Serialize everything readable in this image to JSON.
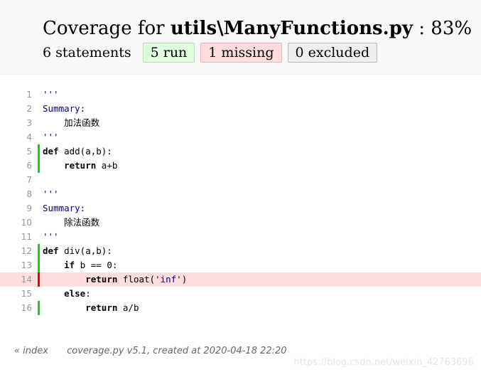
{
  "header": {
    "title_prefix": "Coverage for ",
    "title_file": "utils\\ManyFunctions.py",
    "title_suffix": " : 83%",
    "statements_label": "6 statements",
    "run_label": "5 run",
    "missing_label": "1 missing",
    "excluded_label": "0 excluded"
  },
  "source_lines": [
    {
      "n": "1",
      "status": "",
      "segments": [
        {
          "t": "'''",
          "c": "str"
        }
      ]
    },
    {
      "n": "2",
      "status": "",
      "segments": [
        {
          "t": "Summary:",
          "c": "str"
        }
      ]
    },
    {
      "n": "3",
      "status": "",
      "segments": [
        {
          "t": "    加法函数",
          "c": ""
        }
      ]
    },
    {
      "n": "4",
      "status": "",
      "segments": [
        {
          "t": "'''",
          "c": "str"
        }
      ]
    },
    {
      "n": "5",
      "status": "run",
      "segments": [
        {
          "t": "def",
          "c": "kw"
        },
        {
          "t": " add(a,b):",
          "c": ""
        }
      ]
    },
    {
      "n": "6",
      "status": "run",
      "segments": [
        {
          "t": "    ",
          "c": ""
        },
        {
          "t": "return",
          "c": "kw"
        },
        {
          "t": " a+b",
          "c": ""
        }
      ]
    },
    {
      "n": "7",
      "status": "",
      "segments": [
        {
          "t": "",
          "c": ""
        }
      ]
    },
    {
      "n": "8",
      "status": "",
      "segments": [
        {
          "t": "'''",
          "c": "str"
        }
      ]
    },
    {
      "n": "9",
      "status": "",
      "segments": [
        {
          "t": "Summary:",
          "c": "str"
        }
      ]
    },
    {
      "n": "10",
      "status": "",
      "segments": [
        {
          "t": "    除法函数",
          "c": ""
        }
      ]
    },
    {
      "n": "11",
      "status": "",
      "segments": [
        {
          "t": "'''",
          "c": "str"
        }
      ]
    },
    {
      "n": "12",
      "status": "run",
      "segments": [
        {
          "t": "def",
          "c": "kw"
        },
        {
          "t": " div(a,b):",
          "c": ""
        }
      ]
    },
    {
      "n": "13",
      "status": "run",
      "segments": [
        {
          "t": "    ",
          "c": ""
        },
        {
          "t": "if",
          "c": "kw"
        },
        {
          "t": " b == 0:",
          "c": ""
        }
      ]
    },
    {
      "n": "14",
      "status": "mis",
      "segments": [
        {
          "t": "        ",
          "c": ""
        },
        {
          "t": "return",
          "c": "kw"
        },
        {
          "t": " float(",
          "c": ""
        },
        {
          "t": "'inf'",
          "c": "str"
        },
        {
          "t": ")",
          "c": ""
        }
      ]
    },
    {
      "n": "15",
      "status": "",
      "segments": [
        {
          "t": "    ",
          "c": ""
        },
        {
          "t": "else",
          "c": "kw"
        },
        {
          "t": ":",
          "c": ""
        }
      ]
    },
    {
      "n": "16",
      "status": "run",
      "segments": [
        {
          "t": "        ",
          "c": ""
        },
        {
          "t": "return",
          "c": "kw"
        },
        {
          "t": " a/b",
          "c": ""
        }
      ]
    }
  ],
  "footer": {
    "index_link": "« index",
    "generator_text": "coverage.py v5.1, created at 2020-04-18 22:20"
  },
  "watermark": "https://blog.csdn.net/weixin_42763696",
  "colors": {
    "run": "#00dd00",
    "missing": "#ee0000",
    "missing_bg": "#ffdddd"
  }
}
